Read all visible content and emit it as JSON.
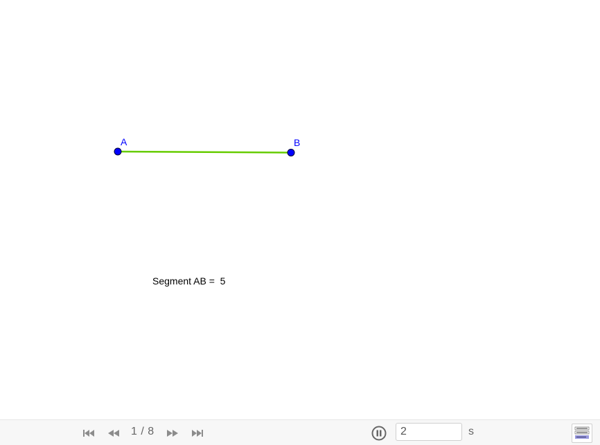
{
  "construction": {
    "point_a_label": "A",
    "point_b_label": "B",
    "segment_readout_prefix": "Segment AB =  ",
    "segment_readout_value": "5",
    "colors": {
      "point_fill": "#0000ff",
      "segment": "#66cc00",
      "label": "#0000ff"
    }
  },
  "player": {
    "step_counter": "1 / 8",
    "speed_value": "2",
    "speed_unit": "s",
    "icons": {
      "first": "skip-to-start-icon",
      "previous": "rewind-icon",
      "next": "fast-forward-icon",
      "last": "skip-to-end-icon",
      "pause": "pause-icon",
      "algebra": "algebra-view-icon"
    }
  }
}
